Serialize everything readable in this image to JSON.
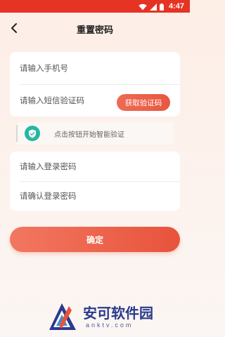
{
  "status_bar": {
    "time": "4:47",
    "color": "#e53324",
    "icons": [
      "wifi-icon",
      "signal-icon",
      "battery-icon"
    ]
  },
  "nav": {
    "title": "重置密码",
    "back_icon": "chevron-left-icon"
  },
  "form": {
    "phone_placeholder": "请输入手机号",
    "sms_code_placeholder": "请输入短信验证码",
    "get_code_label": "获取验证码",
    "verify_text": "点击按钮开始智能验证",
    "verify_icon": "shield-icon",
    "password_placeholder": "请输入登录密码",
    "confirm_password_placeholder": "请确认登录密码",
    "confirm_label": "确定"
  },
  "watermark": {
    "title": "安可软件园",
    "subtitle": "anktv.com"
  },
  "colors": {
    "accent": "#e9573f",
    "verify_badge": "#27b6a2"
  }
}
